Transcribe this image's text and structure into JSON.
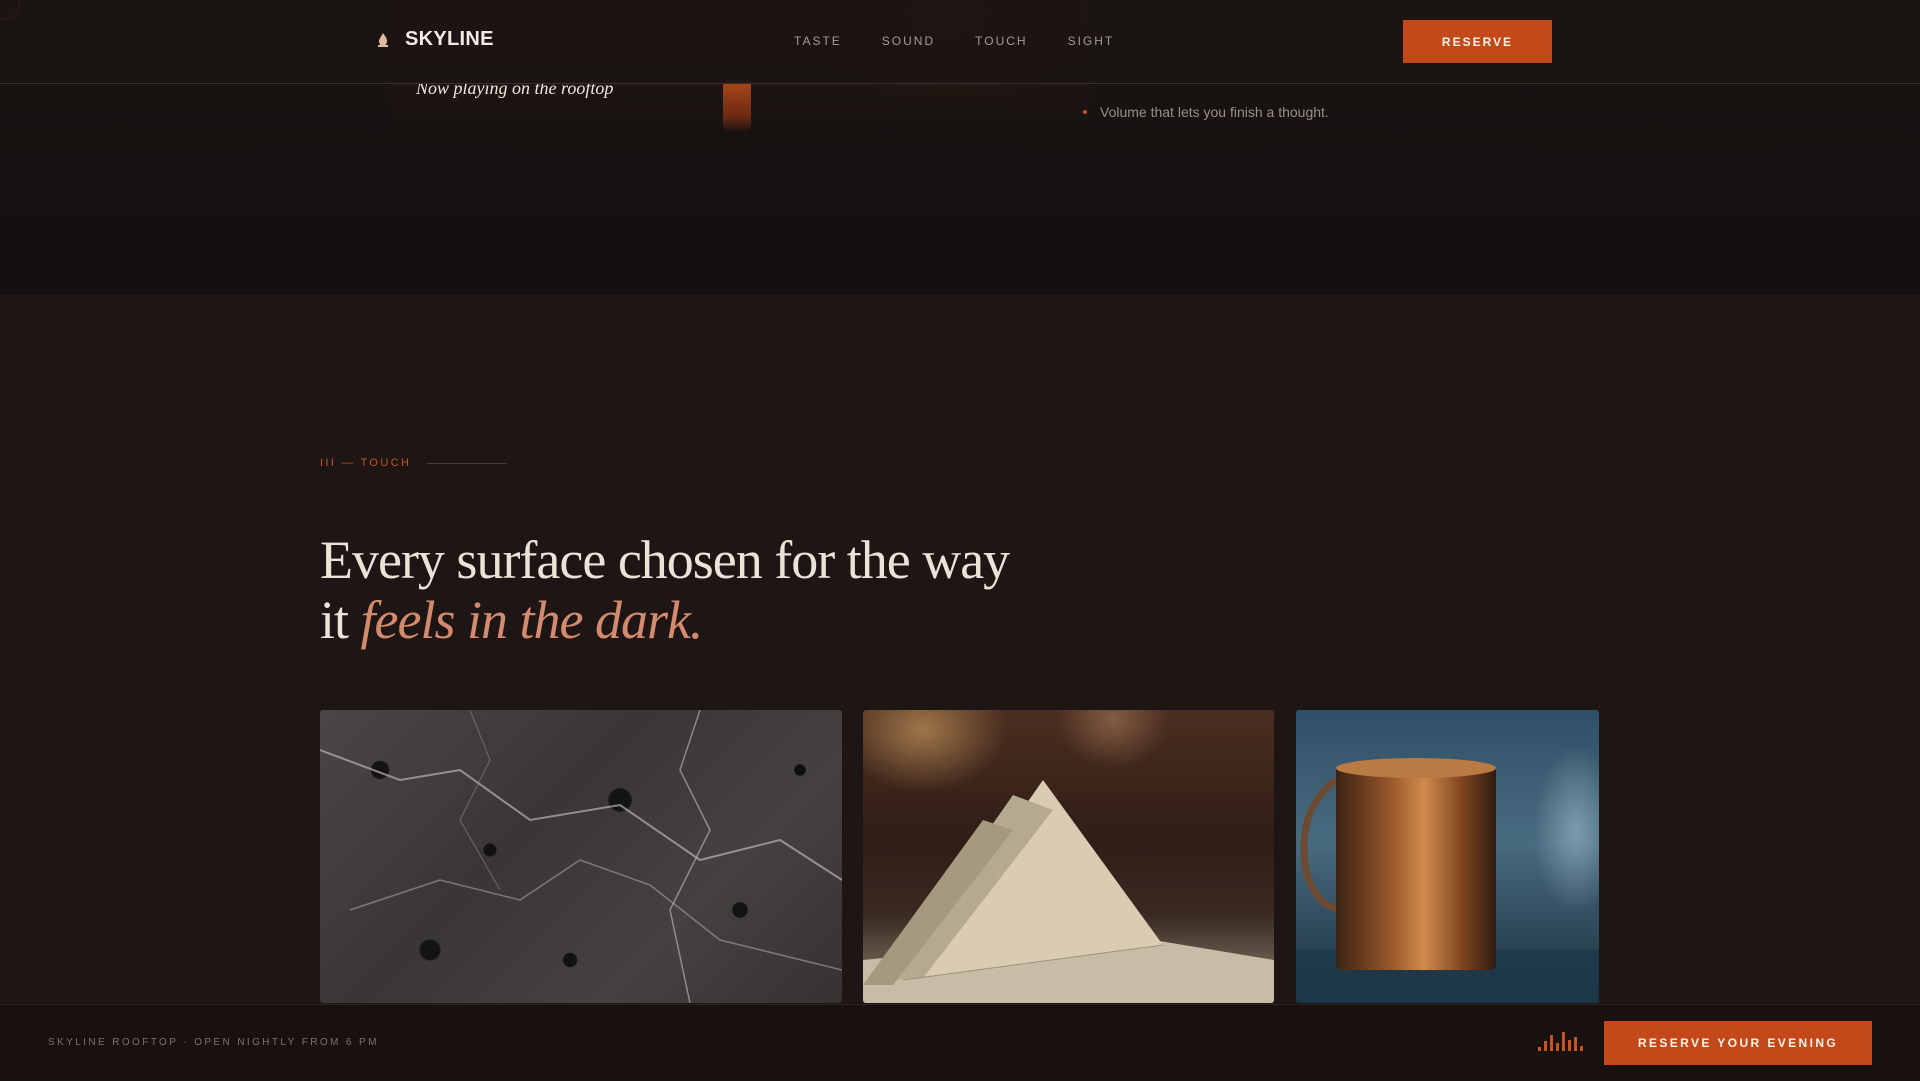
{
  "header": {
    "brand": "SKYLINE",
    "logo_icon": "flame-icon",
    "nav": [
      {
        "label": "TASTE"
      },
      {
        "label": "SOUND"
      },
      {
        "label": "TOUCH"
      },
      {
        "label": "SIGHT"
      }
    ],
    "reserve_label": "RESERVE"
  },
  "previous_section": {
    "caption": "Now playing on the rooftop",
    "list": [
      "Volume that lets you finish a thought."
    ]
  },
  "touch": {
    "eyebrow": "III — TOUCH",
    "headline_plain": "Every surface chosen for the way it ",
    "headline_accent": "feels in the dark.",
    "cards": [
      {
        "name": "stone-photo"
      },
      {
        "name": "linen-napkin-photo"
      },
      {
        "name": "copper-mug-photo"
      }
    ]
  },
  "footer": {
    "text": "SKYLINE ROOFTOP · OPEN NIGHTLY FROM 6 PM",
    "audio_icon": "audio-bars-icon",
    "cta_label": "RESERVE YOUR EVENING"
  },
  "colors": {
    "background": "#1d1614",
    "accent": "#c4491a",
    "headline_accent": "#d48a6e",
    "text": "#ece2d8"
  }
}
